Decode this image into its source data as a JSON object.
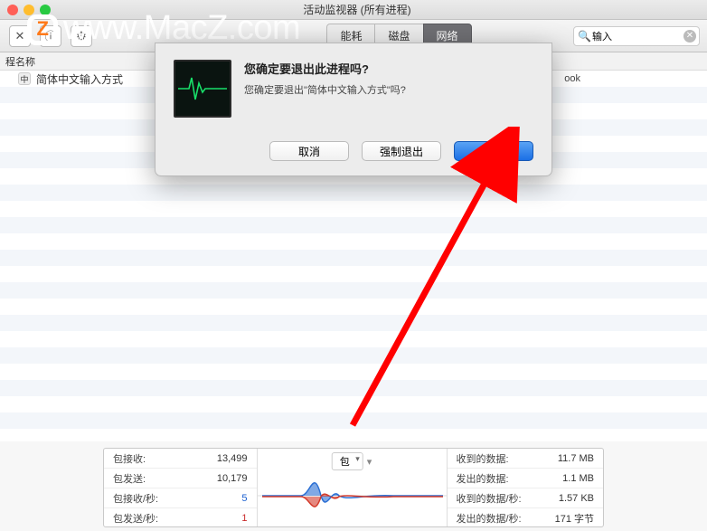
{
  "window": {
    "title": "活动监视器 (所有进程)"
  },
  "toolbar": {
    "tabs": [
      {
        "label": "能耗",
        "active": false
      },
      {
        "label": "磁盘",
        "active": false
      },
      {
        "label": "网络",
        "active": true
      }
    ],
    "search_value": "输入"
  },
  "columns": {
    "name_header": "程名称"
  },
  "process_list": [
    {
      "name": "简体中文输入方式",
      "right": "ook"
    }
  ],
  "dialog": {
    "title": "您确定要退出此进程吗?",
    "message": "您确定要退出\"简体中文输入方式\"吗?",
    "buttons": {
      "cancel": "取消",
      "force": "强制退出",
      "quit": "退出"
    }
  },
  "footer": {
    "left": [
      {
        "label": "包接收:",
        "value": "13,499",
        "cls": ""
      },
      {
        "label": "包发送:",
        "value": "10,179",
        "cls": ""
      },
      {
        "label": "包接收/秒:",
        "value": "5",
        "cls": "blue"
      },
      {
        "label": "包发送/秒:",
        "value": "1",
        "cls": "red"
      }
    ],
    "chart_selector": "包",
    "right": [
      {
        "label": "收到的数据:",
        "value": "11.7 MB"
      },
      {
        "label": "发出的数据:",
        "value": "1.1 MB"
      },
      {
        "label": "收到的数据/秒:",
        "value": "1.57 KB"
      },
      {
        "label": "发出的数据/秒:",
        "value": "171 字节"
      }
    ]
  },
  "watermark": "www.MacZ.com"
}
